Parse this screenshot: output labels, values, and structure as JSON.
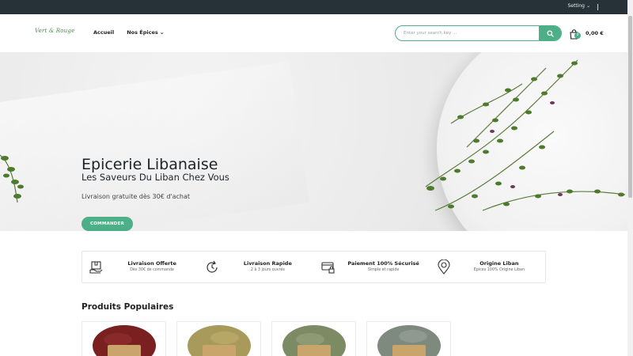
{
  "topbar": {
    "setting_label": "Setting"
  },
  "header": {
    "logo_text": "Vert & Rouge",
    "nav": [
      {
        "label": "Accueil"
      },
      {
        "label": "Nos Épices"
      }
    ],
    "search": {
      "placeholder": "Enter your search key ..."
    },
    "cart": {
      "count": "0",
      "amount": "0,00 €"
    }
  },
  "hero": {
    "title": "Epicerie Libanaise",
    "subtitle": "Les Saveurs Du Liban Chez Vous",
    "promo": "Livraison gratuite dès 30€ d'achat",
    "cta_label": "COMMANDER"
  },
  "features": [
    {
      "icon": "delivery-box-icon",
      "title": "Livraison Offerte",
      "subtitle": "Dès 30€ de commande"
    },
    {
      "icon": "fast-refresh-icon",
      "title": "Livraison Rapide",
      "subtitle": "2 à 3 jours ouvrés"
    },
    {
      "icon": "secure-payment-icon",
      "title": "Paiement 100% Sécurisé",
      "subtitle": "Simple et rapide"
    },
    {
      "icon": "location-origin-icon",
      "title": "Origine Liban",
      "subtitle": "Epices 100% Origine Liban"
    }
  ],
  "products_section": {
    "title": "Produits Populaires"
  },
  "products": [
    {
      "name": "product-sumac",
      "color": "#7a2020"
    },
    {
      "name": "product-thyme-dry",
      "color": "#a89a5a"
    },
    {
      "name": "product-zaatar-leaves",
      "color": "#7d8b65"
    },
    {
      "name": "product-dried-herbs",
      "color": "#7f8a7f"
    }
  ],
  "colors": {
    "accent": "#4caf87",
    "topbar": "#263238"
  }
}
